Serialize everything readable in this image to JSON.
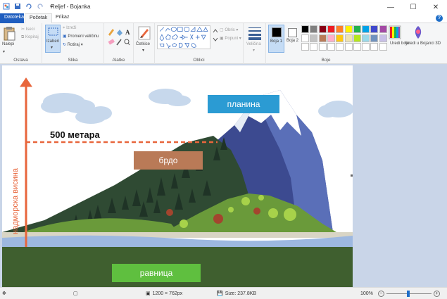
{
  "window": {
    "title": "Reljef - Bojanka"
  },
  "tabs": {
    "file": "Datoteka",
    "home": "Početak",
    "view": "Prikaz"
  },
  "ribbon": {
    "clipboard": {
      "paste": "Nalepi",
      "cut": "Iseci",
      "copy": "Kopiraj",
      "label": "Ostava"
    },
    "image": {
      "select": "Izaberi",
      "crop": "Izreži",
      "resize": "Promeni veličinu",
      "rotate": "Rotiraj",
      "label": "Slika"
    },
    "tools": {
      "label": "Alatke"
    },
    "brushes": {
      "label": "Četkice"
    },
    "shapes": {
      "outline": "Obris",
      "fill": "Popuni",
      "label": "Oblici"
    },
    "size": {
      "label": "Veličina"
    },
    "colors": {
      "color1": "Boja 1",
      "color2": "Boja 2",
      "edit": "Uredi boje",
      "paint3d": "Uredi u Bojanci 3D",
      "label": "Boje",
      "palette_row1": [
        "#000000",
        "#7f7f7f",
        "#880015",
        "#ed1c24",
        "#ff7f27",
        "#fff200",
        "#22b14c",
        "#00a2e8",
        "#3f48cc",
        "#a349a4"
      ],
      "palette_row2": [
        "#ffffff",
        "#c3c3c3",
        "#b97a57",
        "#ffaec9",
        "#ffc90e",
        "#efe4b0",
        "#b5e61d",
        "#99d9ea",
        "#7092be",
        "#c8bfe7"
      ]
    }
  },
  "drawing": {
    "mountain_label": "планина",
    "hill_label": "брдо",
    "plain_label": "равница",
    "height_label": "500 метара",
    "axis_label": "надморска висина",
    "colors": {
      "mountain_label_bg": "#2b9bd3",
      "hill_label_bg": "#b97a57",
      "plain_label_bg": "#5fbf3f",
      "arrow": "#e8663c"
    }
  },
  "status": {
    "dimensions": "1200 × 762px",
    "size": "Size: 237.8KB",
    "zoom": "100%"
  }
}
